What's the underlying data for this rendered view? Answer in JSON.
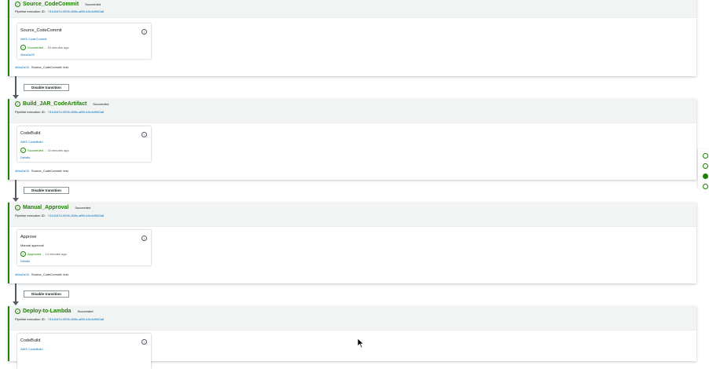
{
  "stages": [
    {
      "name": "Source_CodeCommit",
      "status": "Succeeded",
      "exec_label": "Pipeline execution ID:",
      "exec_id": "741d2d7d-929b-488c-af80-e8c4cf962a6",
      "action": {
        "name": "Source_CodeCommit",
        "provider": "AWS CodeCommit",
        "status": "Succeeded",
        "dash": "-",
        "ago": "16 minutes ago",
        "detail": "46ea2a33"
      },
      "commit_id": "46ea2a33",
      "commit_text": "Source_CodeCommit: test"
    },
    {
      "name": "Build_JAR_CodeArtifact",
      "status": "Succeeded",
      "exec_label": "Pipeline execution ID:",
      "exec_id": "741d2d7d-929b-488c-af80-e8c4cf962a6",
      "action": {
        "name": "CodeBuild",
        "provider": "AWS CodeBuild",
        "status": "Succeeded",
        "dash": "-",
        "ago": "16 minutes ago",
        "detail": "Details"
      },
      "commit_id": "46ea2a33",
      "commit_text": "Source_CodeCommit: test"
    },
    {
      "name": "Manual_Approval",
      "status": "Succeeded",
      "exec_label": "Pipeline execution ID:",
      "exec_id": "741d2d7d-929b-488c-af80-e8c4cf962a6",
      "action": {
        "name": "Approve",
        "provider": "Manual approval",
        "status": "Approved",
        "dash": "-",
        "ago": "14 minutes ago",
        "detail": "Details"
      },
      "commit_id": "46ea2a33",
      "commit_text": "Source_CodeCommit: test"
    },
    {
      "name": "Deploy-to-Lambda",
      "status": "Succeeded",
      "exec_label": "Pipeline execution ID:",
      "exec_id": "741d2d7d-929b-488c-af80-e8c4cf962a6",
      "action": {
        "name": "CodeBuild",
        "provider": "AWS CodeBuild"
      }
    }
  ],
  "transition_label": "Disable transition",
  "icons": {
    "stage_status": "check-circle-icon",
    "info": "info-icon",
    "arrow": "arrow-down-icon",
    "cursor": "mouse-pointer-icon"
  },
  "colors": {
    "success": "#1d8102",
    "link": "#0073bb",
    "header_bg": "#f2f3f3"
  }
}
